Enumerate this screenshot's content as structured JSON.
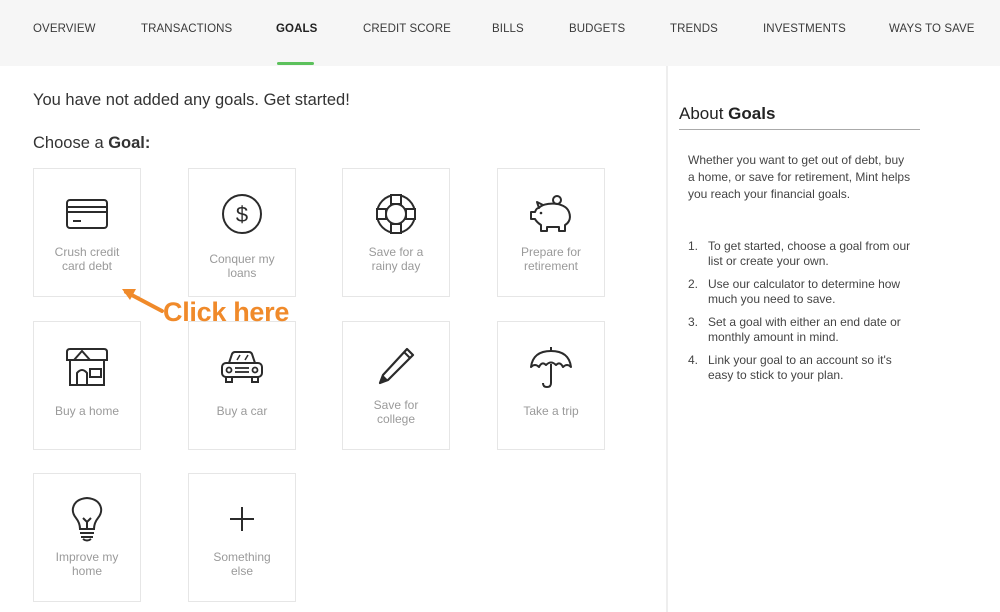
{
  "nav": {
    "items": [
      {
        "label": "OVERVIEW"
      },
      {
        "label": "TRANSACTIONS"
      },
      {
        "label": "GOALS",
        "active": true
      },
      {
        "label": "CREDIT SCORE"
      },
      {
        "label": "BILLS"
      },
      {
        "label": "BUDGETS"
      },
      {
        "label": "TRENDS"
      },
      {
        "label": "INVESTMENTS"
      },
      {
        "label": "WAYS TO SAVE"
      }
    ],
    "active_color": "#5cc15c"
  },
  "main": {
    "intro": "You have not added any goals. Get started!",
    "choose_prefix": "Choose a ",
    "choose_bold": "Goal:",
    "goals": [
      {
        "icon": "credit-card-icon",
        "line1": "Crush credit",
        "line2": "card debt"
      },
      {
        "icon": "dollar-circle-icon",
        "line1": "Conquer my",
        "line2": "loans"
      },
      {
        "icon": "life-ring-icon",
        "line1": "Save for a",
        "line2": "rainy day"
      },
      {
        "icon": "piggy-bank-icon",
        "line1": "Prepare for",
        "line2": "retirement"
      },
      {
        "icon": "house-icon",
        "line1": "Buy a home",
        "line2": ""
      },
      {
        "icon": "car-icon",
        "line1": "Buy a car",
        "line2": ""
      },
      {
        "icon": "pencil-icon",
        "line1": "Save for",
        "line2": "college"
      },
      {
        "icon": "umbrella-icon",
        "line1": "Take a trip",
        "line2": ""
      },
      {
        "icon": "lightbulb-icon",
        "line1": "Improve my",
        "line2": "home"
      },
      {
        "icon": "plus-icon",
        "line1": "Something",
        "line2": "else"
      }
    ]
  },
  "annotation": {
    "text": "Click here",
    "color": "#f08a2a"
  },
  "about": {
    "title_prefix": "About ",
    "title_bold": "Goals",
    "description": "Whether you want to get out of debt, buy a home, or save for retirement, Mint helps you reach your financial goals.",
    "steps": [
      {
        "num": "1.",
        "text": "To get started, choose a goal from our list or create your own."
      },
      {
        "num": "2.",
        "text": "Use our calculator to determine how much you need to save."
      },
      {
        "num": "3.",
        "text": "Set a goal with either an end date or monthly amount in mind."
      },
      {
        "num": "4.",
        "text": "Link your goal to an account so it's easy to stick to your plan."
      }
    ]
  }
}
